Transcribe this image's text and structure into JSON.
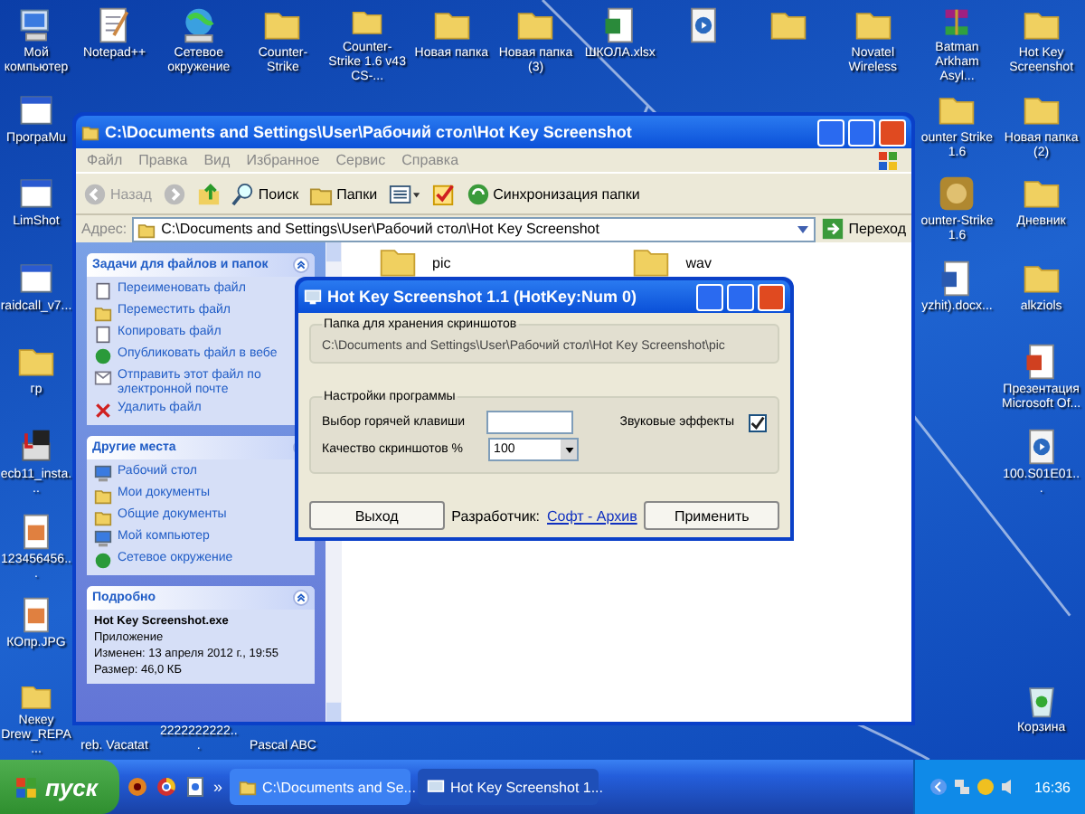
{
  "desktop": {
    "icons": [
      {
        "label": "Мой компьютер",
        "kind": "computer"
      },
      {
        "label": "Notepad++",
        "kind": "notepad"
      },
      {
        "label": "Сетевое окружение",
        "kind": "network"
      },
      {
        "label": "Counter-Strike",
        "kind": "folder"
      },
      {
        "label": "Counter-Strike 1.6 v43 CS-...",
        "kind": "folder"
      },
      {
        "label": "Новая папка",
        "kind": "folder"
      },
      {
        "label": "Новая папка (3)",
        "kind": "folder"
      },
      {
        "label": "ШКОЛА.xlsx",
        "kind": "spreadsheet"
      },
      {
        "kind": "media"
      },
      {
        "kind": "folder"
      },
      {
        "label": "Novatel Wireless",
        "kind": "folder"
      },
      {
        "label": "Batman Arkham Asyl...",
        "kind": "archive"
      },
      {
        "label": "Hot Key Screenshot",
        "kind": "folder"
      },
      {
        "label": "ПрограMu",
        "kind": "app"
      },
      {
        "label": "ounter Strike 1.6",
        "kind": "folder"
      },
      {
        "label": "Новая папка (2)",
        "kind": "folder"
      },
      {
        "label": "LimShot",
        "kind": "app"
      },
      {
        "label": "ounter-Strike 1.6",
        "kind": "game"
      },
      {
        "label": "Дневник",
        "kind": "folder"
      },
      {
        "label": "raidcall_v7...",
        "kind": "app"
      },
      {
        "label": "yzhit).docx...",
        "kind": "document"
      },
      {
        "label": "alkziols",
        "kind": "folder"
      },
      {
        "label": "гр",
        "kind": "folder"
      },
      {
        "label": "Презентация Microsoft Of...",
        "kind": "presentation"
      },
      {
        "label": "ecb11_insta...",
        "kind": "installer"
      },
      {
        "label": "100.S01E01...",
        "kind": "media"
      },
      {
        "label": "123456456...",
        "kind": "image"
      },
      {
        "label": "КОпр.JPG",
        "kind": "image"
      },
      {
        "label": "Nекеу Drew_REPA...",
        "kind": "folder"
      },
      {
        "label": "reb. Vacatat"
      },
      {
        "label": "2222222222..."
      },
      {
        "label": "Pascal ABC"
      },
      {
        "label": "Корзина",
        "kind": "recycle"
      }
    ]
  },
  "explorer": {
    "title": "C:\\Documents and Settings\\User\\Рабочий стол\\Hot Key Screenshot",
    "menu": [
      "Файл",
      "Правка",
      "Вид",
      "Избранное",
      "Сервис",
      "Справка"
    ],
    "toolbar": {
      "back": "Назад",
      "search": "Поиск",
      "folders": "Папки",
      "sync": "Синхронизация папки"
    },
    "address": {
      "label": "Адрес:",
      "value": "C:\\Documents and Settings\\User\\Рабочий стол\\Hot Key Screenshot",
      "go": "Переход"
    },
    "panels": [
      {
        "title": "Задачи для файлов и папок",
        "items": [
          {
            "label": "Переименовать файл",
            "kind": "rename"
          },
          {
            "label": "Переместить файл",
            "kind": "move"
          },
          {
            "label": "Копировать файл",
            "kind": "copy"
          },
          {
            "label": "Опубликовать файл в вебе",
            "kind": "web"
          },
          {
            "label": "Отправить этот файл по электронной почте",
            "kind": "mail"
          },
          {
            "label": "Удалить файл",
            "kind": "delete"
          }
        ]
      },
      {
        "title": "Другие места",
        "items": [
          {
            "label": "Рабочий стол",
            "kind": "desktop"
          },
          {
            "label": "Мои документы",
            "kind": "docs"
          },
          {
            "label": "Общие документы",
            "kind": "folder"
          },
          {
            "label": "Мой компьютер",
            "kind": "computer"
          },
          {
            "label": "Сетевое окружение",
            "kind": "network"
          }
        ]
      }
    ],
    "details": {
      "title": "Подробно",
      "name": "Hot Key Screenshot.exe",
      "type": "Приложение",
      "modified": "Изменен: 13 апреля 2012 г., 19:55",
      "size": "Размер: 46,0 КБ"
    },
    "files": [
      {
        "label": "pic"
      },
      {
        "label": "wav"
      }
    ]
  },
  "dialog": {
    "title": "Hot Key Screenshot 1.1 (HotKey:Num 0)",
    "folder_group": {
      "legend": "Папка для хранения скриншотов",
      "path": "C:\\Documents and Settings\\User\\Рабочий стол\\Hot Key Screenshot\\pic"
    },
    "settings_group": {
      "legend": "Настройки программы",
      "hotkey_label": "Выбор горячей клавиши",
      "sound_label": "Звуковые эффекты",
      "sound_checked": true,
      "quality_label": "Качество скриншотов %",
      "quality_value": "100"
    },
    "exit_button": "Выход",
    "developer_label": "Разработчик:",
    "developer_link": "Софт - Архив",
    "apply_button": "Применить"
  },
  "taskbar": {
    "start": "пуск",
    "more": "»",
    "tasks": [
      {
        "label": "C:\\Documents and Se...",
        "selected": false
      },
      {
        "label": "Hot Key Screenshot 1...",
        "selected": true
      }
    ],
    "clock": "16:36"
  }
}
